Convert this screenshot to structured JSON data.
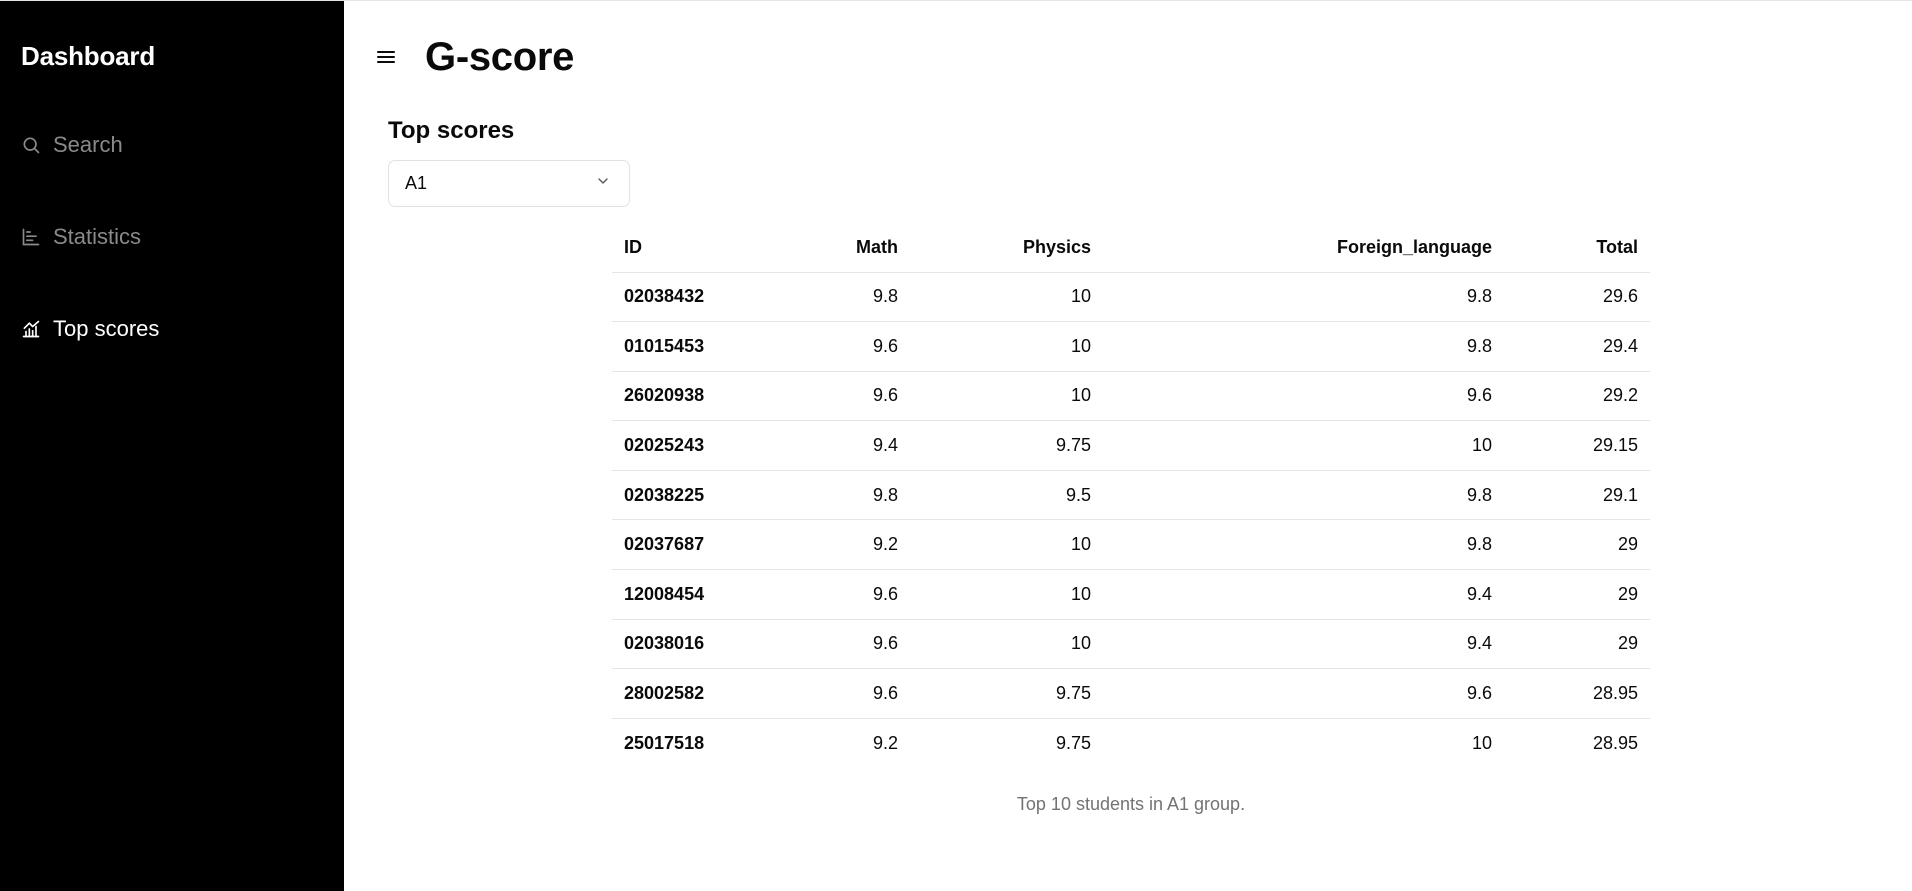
{
  "sidebar": {
    "brand": "Dashboard",
    "items": [
      {
        "label": "Search",
        "icon": "search-icon",
        "active": false
      },
      {
        "label": "Statistics",
        "icon": "bar-chart-icon",
        "active": false
      },
      {
        "label": "Top scores",
        "icon": "line-chart-icon",
        "active": true
      }
    ]
  },
  "header": {
    "title": "G-score"
  },
  "section": {
    "title": "Top scores",
    "group_select": {
      "value": "A1"
    }
  },
  "table": {
    "columns": [
      "ID",
      "Math",
      "Physics",
      "Foreign_language",
      "Total"
    ],
    "rows": [
      [
        "02038432",
        "9.8",
        "10",
        "9.8",
        "29.6"
      ],
      [
        "01015453",
        "9.6",
        "10",
        "9.8",
        "29.4"
      ],
      [
        "26020938",
        "9.6",
        "10",
        "9.6",
        "29.2"
      ],
      [
        "02025243",
        "9.4",
        "9.75",
        "10",
        "29.15"
      ],
      [
        "02038225",
        "9.8",
        "9.5",
        "9.8",
        "29.1"
      ],
      [
        "02037687",
        "9.2",
        "10",
        "9.8",
        "29"
      ],
      [
        "12008454",
        "9.6",
        "10",
        "9.4",
        "29"
      ],
      [
        "02038016",
        "9.6",
        "10",
        "9.4",
        "29"
      ],
      [
        "28002582",
        "9.6",
        "9.75",
        "9.6",
        "28.95"
      ],
      [
        "25017518",
        "9.2",
        "9.75",
        "10",
        "28.95"
      ]
    ],
    "caption": "Top 10 students in A1 group."
  },
  "colors": {
    "sidebar_bg": "#000000",
    "nav_inactive": "#8a8a8a",
    "nav_active": "#ffffff",
    "caption": "#737373"
  }
}
